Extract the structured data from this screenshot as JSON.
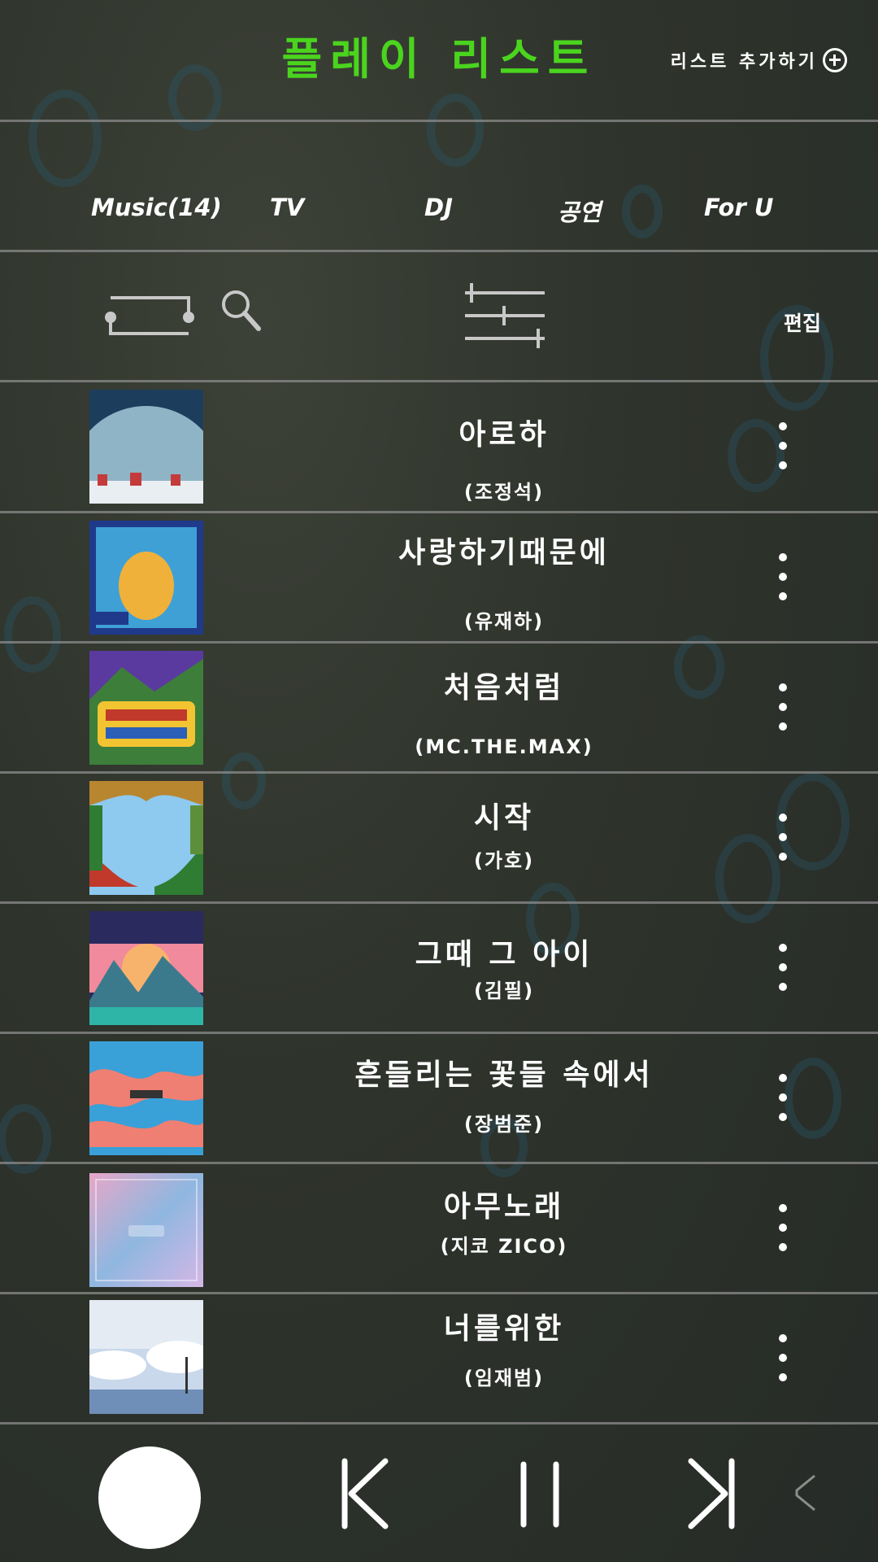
{
  "header": {
    "title": "플레이 리스트",
    "add_list_label": "리스트 추가하기"
  },
  "tabs": [
    {
      "label": "Music(14)"
    },
    {
      "label": "TV"
    },
    {
      "label": "DJ"
    },
    {
      "label": "공연"
    },
    {
      "label": "For U"
    }
  ],
  "toolbar": {
    "toggle_icon": "toggle-icon",
    "search_icon": "search-icon",
    "filter_icon": "sliders-icon",
    "edit_label": "편집"
  },
  "songs": [
    {
      "title": "아로하",
      "artist": "(조정석)",
      "cover_colors": [
        "#1d3d5c",
        "#8fb4c6"
      ]
    },
    {
      "title": "사랑하기때문에",
      "artist": "(유재하)",
      "cover_colors": [
        "#1f3a8a",
        "#f0b13a"
      ]
    },
    {
      "title": "처음처럼",
      "artist": "(MC.THE.MAX)",
      "cover_colors": [
        "#5b3aa0",
        "#f2c431"
      ]
    },
    {
      "title": "시작",
      "artist": "(가호)",
      "cover_colors": [
        "#8ec9ef",
        "#2e7d32"
      ]
    },
    {
      "title": "그때 그 아이",
      "artist": "(김필)",
      "cover_colors": [
        "#f08a9c",
        "#2fb5a8"
      ]
    },
    {
      "title": "흔들리는 꽃들 속에서",
      "artist": "(장범준)",
      "cover_colors": [
        "#3aa0d8",
        "#ef7f72"
      ]
    },
    {
      "title": "아무노래",
      "artist": "(지코 ZICO)",
      "cover_colors": [
        "#e7a7c8",
        "#8fb7e0"
      ]
    },
    {
      "title": "너를위한",
      "artist": "(임재범)",
      "cover_colors": [
        "#c9d8ea",
        "#6f8fb8"
      ]
    }
  ],
  "player": {
    "album_placeholder": "album-art-placeholder",
    "prev_icon": "previous-icon",
    "pause_icon": "pause-icon",
    "next_icon": "next-icon",
    "collapse_icon": "chevron-left-icon"
  }
}
